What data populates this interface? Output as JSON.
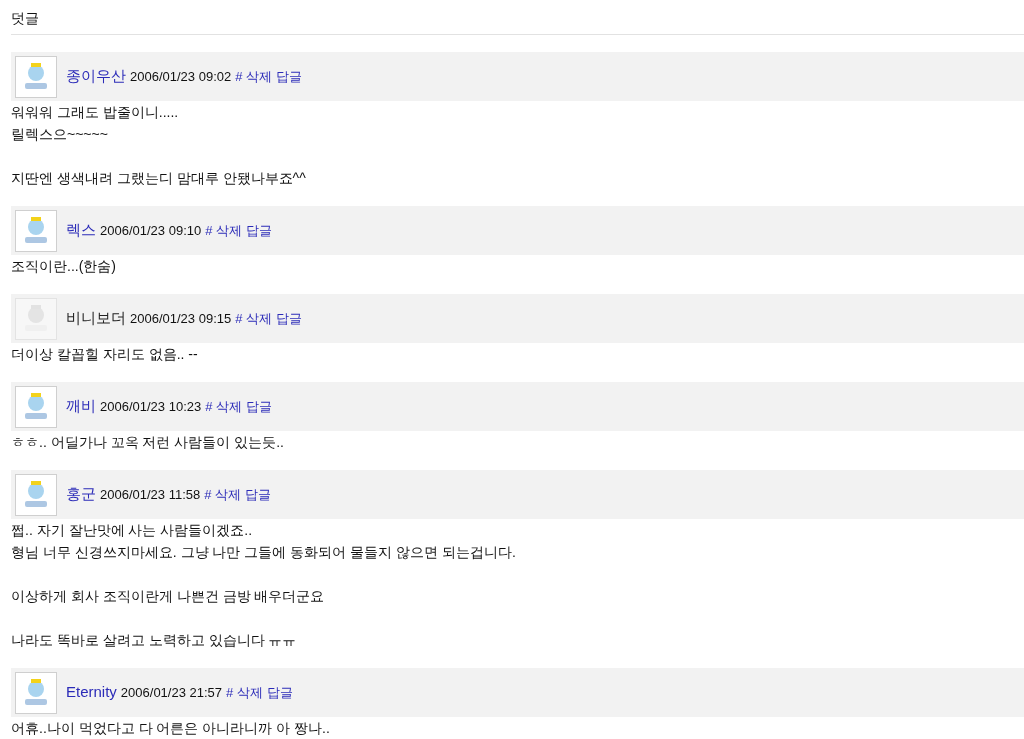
{
  "section_title": "덧글",
  "comments": [
    {
      "author": "종이우산",
      "linked": true,
      "avatar_faded": false,
      "time": "2006/01/23 09:02",
      "actions": [
        "#",
        "삭제",
        "답글"
      ],
      "paragraphs": [
        [
          "워워워 그래도 밥줄이니.....",
          "릴렉스으~~~~~"
        ],
        [
          "지딴엔 생색내려 그랬는디 맘대루 안됐나부죠^^"
        ]
      ]
    },
    {
      "author": "렉스",
      "linked": true,
      "avatar_faded": false,
      "time": "2006/01/23 09:10",
      "actions": [
        "#",
        "삭제",
        "답글"
      ],
      "paragraphs": [
        [
          "조직이란...(한숨)"
        ]
      ]
    },
    {
      "author": "비니보더",
      "linked": false,
      "avatar_faded": true,
      "time": "2006/01/23 09:15",
      "actions": [
        "#",
        "삭제",
        "답글"
      ],
      "paragraphs": [
        [
          "더이상 칼꼽힐 자리도 없음.. --"
        ]
      ]
    },
    {
      "author": "깨비",
      "linked": true,
      "avatar_faded": false,
      "time": "2006/01/23 10:23",
      "actions": [
        "#",
        "삭제",
        "답글"
      ],
      "paragraphs": [
        [
          "ㅎㅎ.. 어딜가나 꼬옥 저런 사람들이 있는듯.."
        ]
      ]
    },
    {
      "author": "홍군",
      "linked": true,
      "avatar_faded": false,
      "time": "2006/01/23 11:58",
      "actions": [
        "#",
        "삭제",
        "답글"
      ],
      "paragraphs": [
        [
          "쩝.. 자기 잘난맛에 사는 사람들이겠죠..",
          "형님 너무 신경쓰지마세요. 그냥 나만 그들에 동화되어 물들지 않으면 되는겁니다."
        ],
        [
          "이상하게 회사 조직이란게 나쁜건 금방 배우더군요"
        ],
        [
          "나라도 똑바로 살려고 노력하고 있습니다 ㅠㅠ"
        ]
      ]
    },
    {
      "author": "Eternity",
      "linked": true,
      "avatar_faded": false,
      "time": "2006/01/23 21:57",
      "actions": [
        "#",
        "삭제",
        "답글"
      ],
      "paragraphs": [
        [
          "어휴..나이 먹었다고 다 어른은 아니라니까 아 짱나.."
        ]
      ]
    }
  ]
}
